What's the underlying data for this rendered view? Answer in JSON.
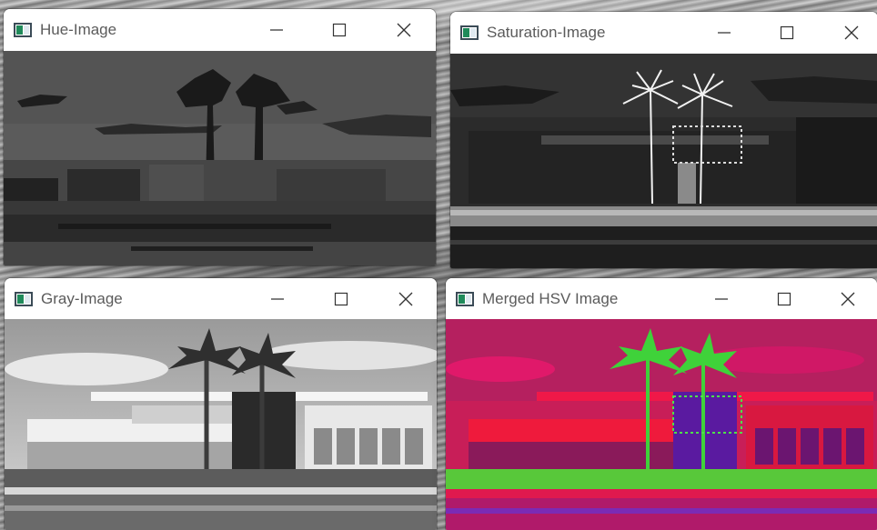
{
  "windows": {
    "hue": {
      "title": "Hue-Image"
    },
    "saturation": {
      "title": "Saturation-Image"
    },
    "gray": {
      "title": "Gray-Image"
    },
    "merged": {
      "title": "Merged HSV Image"
    }
  },
  "icons": {
    "minimize": "minimize-icon",
    "maximize": "maximize-icon",
    "close": "close-icon",
    "app": "image-window-icon"
  },
  "colors": {
    "titlebar": "#ffffff",
    "title_text": "#5b5b5b",
    "merged_primary": "#e0194e",
    "merged_green": "#3fd23a",
    "merged_purple": "#7b2bb5"
  }
}
